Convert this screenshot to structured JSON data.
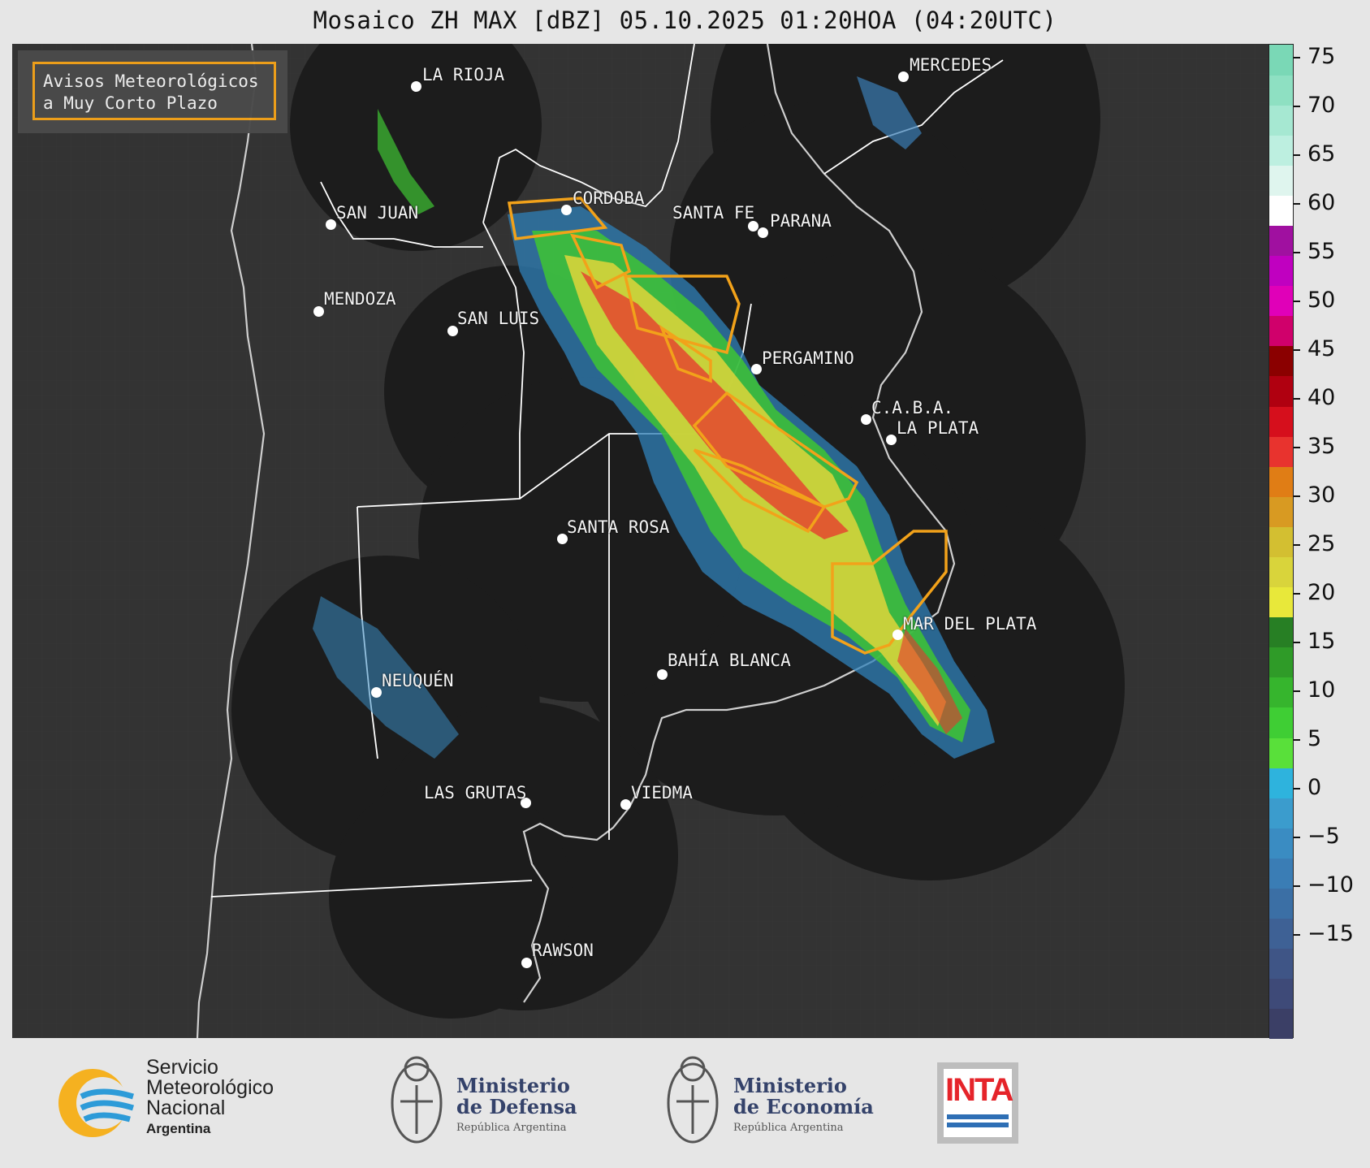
{
  "title": "Mosaico ZH MAX [dBZ] 05.10.2025 01:20HOA (04:20UTC)",
  "legend": {
    "text_line1": "Avisos Meteorológicos",
    "text_line2": "a Muy Corto Plazo",
    "outline_color": "#f2a21a"
  },
  "cities": [
    {
      "name": "LA RIOJA"
    },
    {
      "name": "CORDOBA"
    },
    {
      "name": "SAN JUAN"
    },
    {
      "name": "SANTA FE"
    },
    {
      "name": "PARANA"
    },
    {
      "name": "MERCEDES"
    },
    {
      "name": "MENDOZA"
    },
    {
      "name": "SAN LUIS"
    },
    {
      "name": "PERGAMINO"
    },
    {
      "name": "C.A.B.A."
    },
    {
      "name": "LA PLATA"
    },
    {
      "name": "SANTA ROSA"
    },
    {
      "name": "MAR DEL PLATA"
    },
    {
      "name": "BAHÍA BLANCA"
    },
    {
      "name": "NEUQUÉN"
    },
    {
      "name": "LAS GRUTAS"
    },
    {
      "name": "VIEDMA"
    },
    {
      "name": "RAWSON"
    }
  ],
  "colorbar": {
    "ticks": [
      "75",
      "70",
      "65",
      "60",
      "55",
      "50",
      "45",
      "40",
      "35",
      "30",
      "25",
      "20",
      "15",
      "10",
      "5",
      "0",
      "−5",
      "−10",
      "−15"
    ],
    "colors": [
      "#3b3f66",
      "#3e4a78",
      "#3f5586",
      "#3e6195",
      "#3b6fa5",
      "#3a7db5",
      "#3a8cc2",
      "#3b9ccd",
      "#2eb3dd",
      "#59e03a",
      "#3fce34",
      "#36b52d",
      "#2f9b28",
      "#277f24",
      "#e8e83a",
      "#d9d43b",
      "#d3bf31",
      "#d89a22",
      "#e07d15",
      "#e8332e",
      "#d60f1c",
      "#b00010",
      "#8b0000",
      "#d0006b",
      "#e000b8",
      "#c000c0",
      "#a010a0",
      "#ffffff",
      "#dff5ee",
      "#bdefe0",
      "#a6e8d2",
      "#8ee0c2",
      "#7ad8b6"
    ]
  },
  "logos": {
    "smn_line1": "Servicio",
    "smn_line2": "Meteorológico",
    "smn_line3": "Nacional",
    "smn_line4": "Argentina",
    "defensa_line1": "Ministerio",
    "defensa_line2": "de Defensa",
    "defensa_line3": "República Argentina",
    "economia_line1": "Ministerio",
    "economia_line2": "de Economía",
    "economia_line3": "República Argentina",
    "inta": "INTA"
  }
}
